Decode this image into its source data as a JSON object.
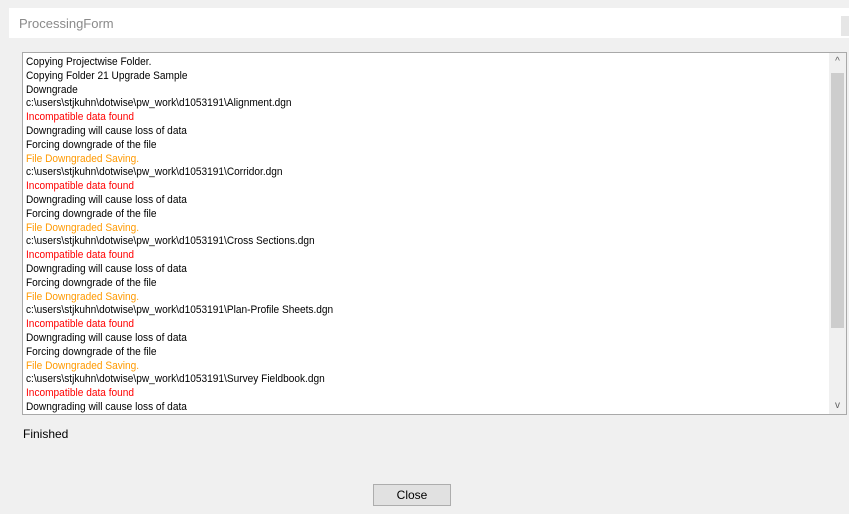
{
  "window": {
    "title": "ProcessingForm"
  },
  "log": {
    "lines": [
      {
        "text": "Copying Projectwise Folder.",
        "type": "normal"
      },
      {
        "text": "Copying Folder 21 Upgrade Sample",
        "type": "normal"
      },
      {
        "text": "Downgrade",
        "type": "normal"
      },
      {
        "text": "c:\\users\\stjkuhn\\dotwise\\pw_work\\d1053191\\Alignment.dgn",
        "type": "normal"
      },
      {
        "text": "Incompatible data found",
        "type": "error"
      },
      {
        "text": "Downgrading will cause loss of data",
        "type": "normal"
      },
      {
        "text": "Forcing downgrade of the file",
        "type": "normal"
      },
      {
        "text": "File Downgraded Saving.",
        "type": "warning"
      },
      {
        "text": "c:\\users\\stjkuhn\\dotwise\\pw_work\\d1053191\\Corridor.dgn",
        "type": "normal"
      },
      {
        "text": "Incompatible data found",
        "type": "error"
      },
      {
        "text": "Downgrading will cause loss of data",
        "type": "normal"
      },
      {
        "text": "Forcing downgrade of the file",
        "type": "normal"
      },
      {
        "text": "File Downgraded Saving.",
        "type": "warning"
      },
      {
        "text": "c:\\users\\stjkuhn\\dotwise\\pw_work\\d1053191\\Cross Sections.dgn",
        "type": "normal"
      },
      {
        "text": "Incompatible data found",
        "type": "error"
      },
      {
        "text": "Downgrading will cause loss of data",
        "type": "normal"
      },
      {
        "text": "Forcing downgrade of the file",
        "type": "normal"
      },
      {
        "text": "File Downgraded Saving.",
        "type": "warning"
      },
      {
        "text": "c:\\users\\stjkuhn\\dotwise\\pw_work\\d1053191\\Plan-Profile Sheets.dgn",
        "type": "normal"
      },
      {
        "text": "Incompatible data found",
        "type": "error"
      },
      {
        "text": "Downgrading will cause loss of data",
        "type": "normal"
      },
      {
        "text": "Forcing downgrade of the file",
        "type": "normal"
      },
      {
        "text": "File Downgraded Saving.",
        "type": "warning"
      },
      {
        "text": "c:\\users\\stjkuhn\\dotwise\\pw_work\\d1053191\\Survey Fieldbook.dgn",
        "type": "normal"
      },
      {
        "text": "Incompatible data found",
        "type": "error"
      },
      {
        "text": "Downgrading will cause loss of data",
        "type": "normal"
      }
    ]
  },
  "scrollbar": {
    "up_icon": "chevron-up-icon",
    "down_icon": "chevron-down-icon",
    "up_glyph": "^",
    "down_glyph": "v"
  },
  "status": {
    "text": "Finished"
  },
  "buttons": {
    "close_label": "Close"
  },
  "colors": {
    "error": "#ff0000",
    "warning": "#ff9900",
    "normal": "#000000"
  }
}
